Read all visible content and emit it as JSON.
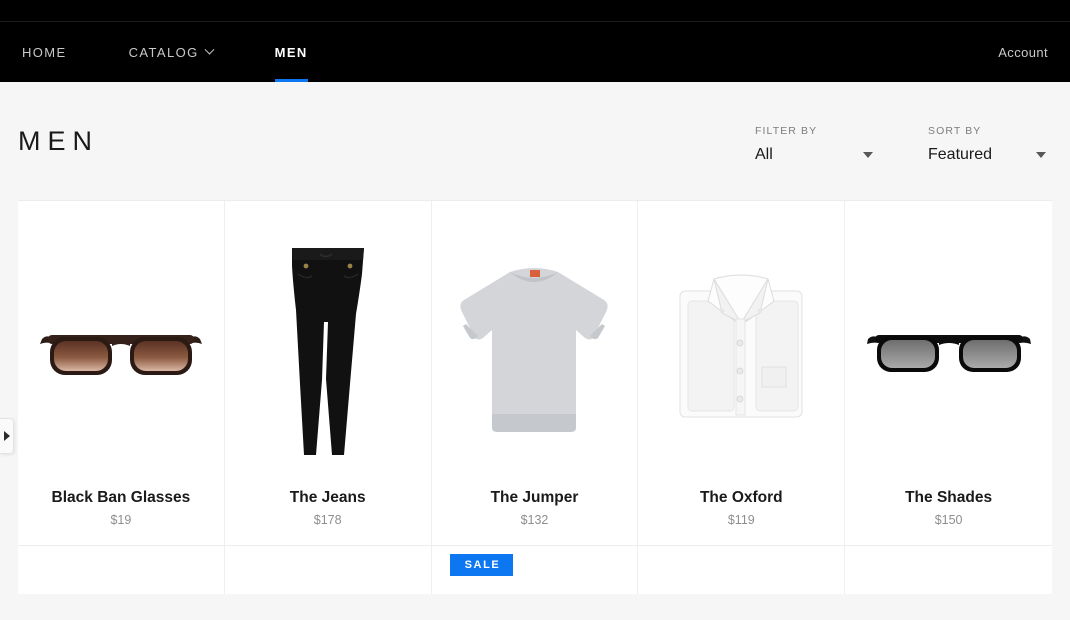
{
  "theme": {
    "accent": "#0d77f2",
    "page_bg": "#f6f6f6",
    "nav_bg": "#000000"
  },
  "nav": {
    "items": [
      {
        "label": "HOME",
        "active": false,
        "has_chevron": false
      },
      {
        "label": "CATALOG",
        "active": false,
        "has_chevron": true
      },
      {
        "label": "MEN",
        "active": true,
        "has_chevron": false
      }
    ],
    "account_label": "Account"
  },
  "page": {
    "title": "MEN"
  },
  "controls": {
    "filter": {
      "label": "FILTER BY",
      "value": "All"
    },
    "sort": {
      "label": "SORT BY",
      "value": "Featured"
    }
  },
  "products": [
    {
      "name": "Black Ban Glasses",
      "price": "$19",
      "image": "brown-sunglasses-image"
    },
    {
      "name": "The Jeans",
      "price": "$178",
      "image": "black-jeans-image"
    },
    {
      "name": "The Jumper",
      "price": "$132",
      "image": "grey-sweatshirt-image"
    },
    {
      "name": "The Oxford",
      "price": "$119",
      "image": "white-shirt-image"
    },
    {
      "name": "The Shades",
      "price": "$150",
      "image": "black-sunglasses-image"
    }
  ],
  "next_row": {
    "sale_badge": "SALE",
    "sale_badge_column": 3
  },
  "drawer": {
    "icon": "triangle-right-icon"
  }
}
